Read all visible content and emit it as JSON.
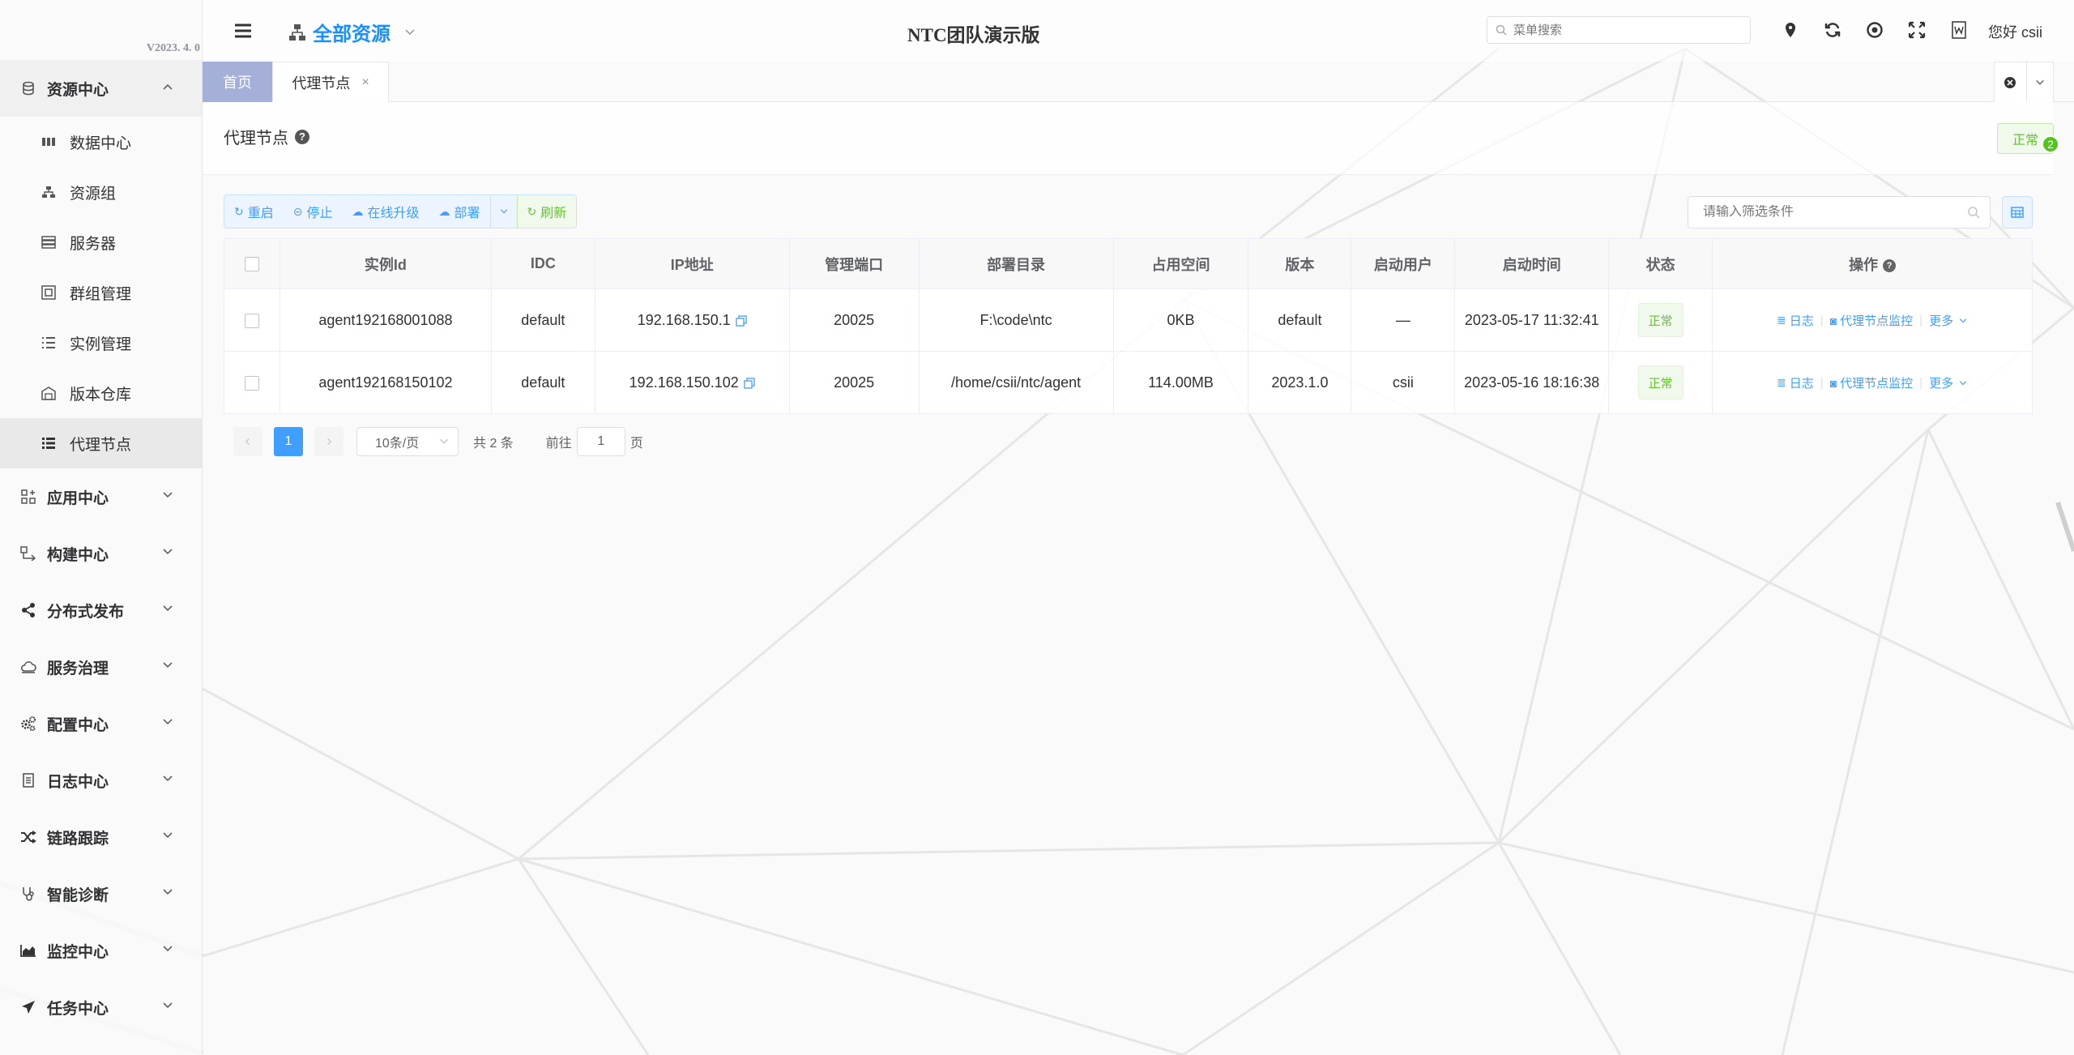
{
  "app": {
    "version": "V2023. 4. 0",
    "title": "NTC团队演示版",
    "resource_switch": "全部资源",
    "greeting": "您好 csii"
  },
  "search": {
    "placeholder": "菜单搜索"
  },
  "sidebar": {
    "groups": [
      {
        "label": "资源中心",
        "icon": "database-icon",
        "open": true,
        "items": [
          {
            "label": "数据中心",
            "icon": "server-rack-icon"
          },
          {
            "label": "资源组",
            "icon": "sitemap-icon"
          },
          {
            "label": "服务器",
            "icon": "server-icon"
          },
          {
            "label": "群组管理",
            "icon": "group-icon"
          },
          {
            "label": "实例管理",
            "icon": "list-icon"
          },
          {
            "label": "版本仓库",
            "icon": "warehouse-icon"
          },
          {
            "label": "代理节点",
            "icon": "list-bullet-icon",
            "active": true
          }
        ]
      },
      {
        "label": "应用中心",
        "icon": "apps-icon"
      },
      {
        "label": "构建中心",
        "icon": "build-icon"
      },
      {
        "label": "分布式发布",
        "icon": "share-icon"
      },
      {
        "label": "服务治理",
        "icon": "cloud-icon"
      },
      {
        "label": "配置中心",
        "icon": "cogs-icon"
      },
      {
        "label": "日志中心",
        "icon": "file-icon"
      },
      {
        "label": "链路跟踪",
        "icon": "shuffle-icon"
      },
      {
        "label": "智能诊断",
        "icon": "stethoscope-icon"
      },
      {
        "label": "监控中心",
        "icon": "area-chart-icon"
      },
      {
        "label": "任务中心",
        "icon": "paper-plane-icon"
      }
    ]
  },
  "tabs": {
    "home": "首页",
    "current": "代理节点"
  },
  "panel": {
    "title": "代理节点",
    "status": "正常",
    "badge": "2"
  },
  "toolbar": {
    "restart": "重启",
    "stop": "停止",
    "upgrade": "在线升级",
    "deploy": "部署",
    "refresh": "刷新",
    "filter_placeholder": "请输入筛选条件"
  },
  "table": {
    "columns": [
      "实例Id",
      "IDC",
      "IP地址",
      "管理端口",
      "部署目录",
      "占用空间",
      "版本",
      "启动用户",
      "启动时间",
      "状态",
      "操作"
    ],
    "rows": [
      {
        "id": "agent192168001088",
        "idc": "default",
        "ip": "192.168.150.1",
        "port": "20025",
        "dir": "F:\\code\\ntc",
        "space": "0KB",
        "version": "default",
        "user": "—",
        "start": "2023-05-17 11:32:41",
        "status": "正常"
      },
      {
        "id": "agent192168150102",
        "idc": "default",
        "ip": "192.168.150.102",
        "port": "20025",
        "dir": "/home/csii/ntc/agent",
        "space": "114.00MB",
        "version": "2023.1.0",
        "user": "csii",
        "start": "2023-05-16 18:16:38",
        "status": "正常"
      }
    ],
    "ops": {
      "log": "日志",
      "monitor": "代理节点监控",
      "more": "更多"
    }
  },
  "pagination": {
    "current": "1",
    "page_size": "10条/页",
    "total": "共 2 条",
    "goto_prefix": "前往",
    "goto_value": "1",
    "goto_suffix": "页"
  },
  "colors": {
    "accent": "#409eff",
    "success": "#67c23a",
    "tab_home": "#a4b0d8"
  }
}
